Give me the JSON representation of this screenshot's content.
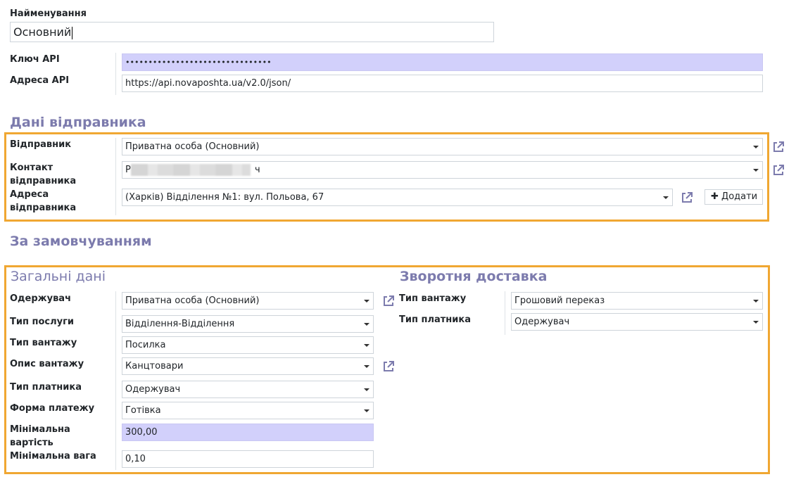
{
  "name_label": "Найменування",
  "name_value": "Основний",
  "api": {
    "key_label": "Ключ API",
    "key_value": "••••••••••••••••••••••••••••••••",
    "url_label": "Адреса API",
    "url_value": "https://api.novaposhta.ua/v2.0/json/"
  },
  "sender": {
    "title": "Дані відправника",
    "sender_label": "Відправник",
    "sender_value": "Приватна особа (Основний)",
    "contact_label_1": "Контакт",
    "contact_label_2": "відправника",
    "contact_prefix": "Р",
    "contact_suffix": "ч",
    "address_label_1": "Адреса",
    "address_label_2": "відправника",
    "address_value": "(Харків) Відділення №1: вул. Польова, 67",
    "add_button": "Додати"
  },
  "defaults": {
    "title": "За замовчуванням",
    "general_title": "Загальні дані",
    "recipient_label": "Одержувач",
    "recipient_value": "Приватна особа (Основний)",
    "service_label": "Тип послуги",
    "service_value": "Відділення-Відділення",
    "cargo_label": "Тип вантажу",
    "cargo_value": "Посилка",
    "cargo_desc_label": "Опис вантажу",
    "cargo_desc_value": "Канцтовари",
    "payer_label": "Тип платника",
    "payer_value": "Одержувач",
    "payment_label": "Форма платежу",
    "payment_value": "Готівка",
    "min_cost_label_1": "Мінімальна",
    "min_cost_label_2": "вартість",
    "min_cost_value": "300,00",
    "min_weight_label": "Мінімальна вага",
    "min_weight_value": "0,10"
  },
  "return": {
    "title": "Зворотня доставка",
    "cargo_label": "Тип вантажу",
    "cargo_value": "Грошовий переказ",
    "payer_label": "Тип платника",
    "payer_value": "Одержувач"
  },
  "icons": {
    "external_link": "external-link-icon",
    "plus": "plus-icon",
    "caret": "caret-down-icon"
  },
  "colors": {
    "accent_heading": "#7c7bad",
    "highlight_frame": "#f0a732",
    "filled_input": "#d2d0fb"
  }
}
